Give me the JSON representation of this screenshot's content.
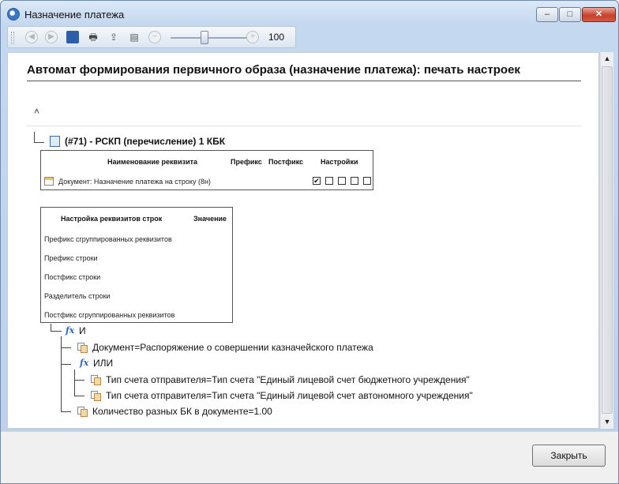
{
  "window": {
    "title": "Назначение платежа"
  },
  "toolbar": {
    "zoom": "100"
  },
  "report": {
    "title": "Автомат формирования первичного образа (назначение платежа): печать настроек",
    "collapse_glyph": "˄",
    "node_title": "(#71) - РСКП (перечисление) 1 КБК",
    "table1": {
      "headers": [
        "Наименование реквизита",
        "Префикс",
        "Постфикс",
        "Настройки"
      ],
      "row": "Документ: Назначение платежа на строку (8н)",
      "checks": [
        "✔",
        "",
        "",
        "",
        ""
      ]
    },
    "table2": {
      "headers": [
        "Настройка реквизитов строк",
        "Значение"
      ],
      "rows": [
        "Префикс сгруппированных реквизитов",
        "Префикс строки",
        "Постфикс строки",
        "Разделитель строки",
        "Постфикс сгруппированных реквизитов"
      ]
    },
    "conditions": {
      "and_label": "И",
      "item1": "Документ=Распоряжение о совершении казначейского платежа",
      "or_label": "ИЛИ",
      "item2": "Тип счета отправителя=Тип счета \"Единый лицевой счет бюджетного учреждения\"",
      "item3": "Тип счета отправителя=Тип счета \"Единый лицевой счет автономного учреждения\"",
      "item4": "Количество разных БК в документе=1.00"
    }
  },
  "footer": {
    "close_label": "Закрыть"
  },
  "icons": [
    "app-icon",
    "back-icon",
    "forward-icon",
    "save-icon",
    "print-icon",
    "export-icon",
    "page-setup-icon",
    "zoom-out-icon",
    "zoom-in-icon",
    "function-icon",
    "condition-icon",
    "grid-icon",
    "document-icon"
  ]
}
